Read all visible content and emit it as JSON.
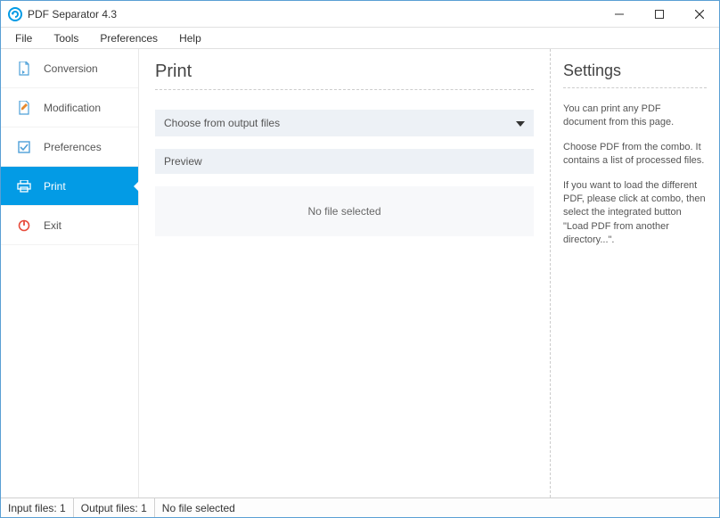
{
  "window": {
    "title": "PDF Separator 4.3"
  },
  "menu": {
    "file": "File",
    "tools": "Tools",
    "preferences": "Preferences",
    "help": "Help"
  },
  "sidebar": {
    "items": [
      {
        "label": "Conversion"
      },
      {
        "label": "Modification"
      },
      {
        "label": "Preferences"
      },
      {
        "label": "Print"
      },
      {
        "label": "Exit"
      }
    ]
  },
  "content": {
    "heading": "Print",
    "combo_label": "Choose from output files",
    "preview_header": "Preview",
    "preview_empty": "No file selected"
  },
  "settings": {
    "heading": "Settings",
    "p1": "You can print any PDF document from this page.",
    "p2": "Choose PDF from the combo. It contains a list of processed files.",
    "p3": "If you want to load the different PDF, please click at combo, then select the integrated button \"Load PDF from another directory...\"."
  },
  "status": {
    "input_label": "Input files:",
    "input_count": "1",
    "output_label": "Output files:",
    "output_count": "1",
    "message": "No file selected"
  }
}
